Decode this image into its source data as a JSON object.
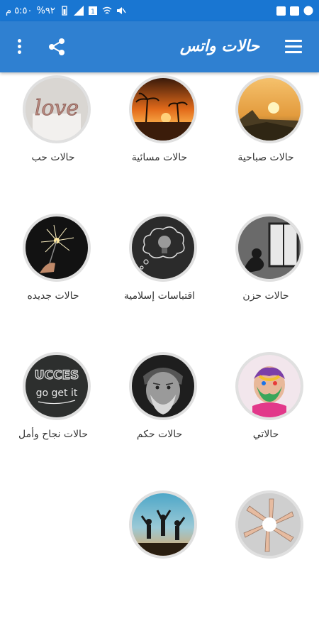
{
  "statusbar": {
    "time": "٥:٥٠ م",
    "battery": "%٩٢"
  },
  "appbar": {
    "title": "حالات واتس",
    "menu_icon": "hamburger-menu-icon",
    "share_icon": "share-icon",
    "more_icon": "more-vert-icon"
  },
  "categories": [
    {
      "label": "حالات صباحية",
      "icon": "sunrise-landscape-image"
    },
    {
      "label": "حالات مسائية",
      "icon": "sunset-palm-image"
    },
    {
      "label": "حالات حب",
      "icon": "love-balloons-image"
    },
    {
      "label": "حالات حزن",
      "icon": "sad-window-image"
    },
    {
      "label": "اقتباسات إسلامية",
      "icon": "lightbulb-thought-image"
    },
    {
      "label": "حالات جديده",
      "icon": "sparkler-image"
    },
    {
      "label": "حالاتي",
      "icon": "colorful-face-image"
    },
    {
      "label": "حالات حكم",
      "icon": "old-man-image"
    },
    {
      "label": "حالات نجاح وأمل",
      "icon": "success-chalkboard-image"
    },
    {
      "label": "",
      "icon": "hands-circle-image"
    },
    {
      "label": "",
      "icon": "friends-jumping-image"
    }
  ]
}
